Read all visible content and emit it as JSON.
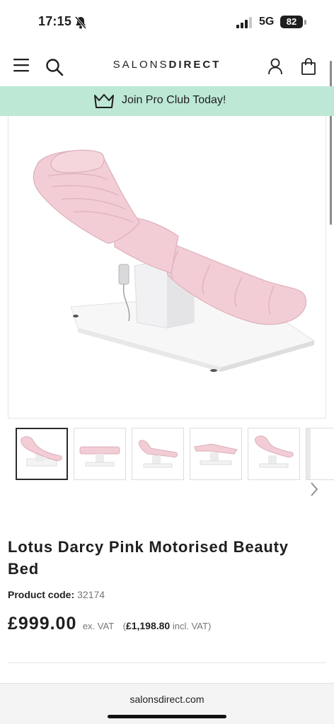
{
  "status_bar": {
    "time": "17:15",
    "network": "5G",
    "battery": "82",
    "icons": [
      "bell-off-icon",
      "signal-icon",
      "battery-icon"
    ]
  },
  "header": {
    "logo_light": "SALONS",
    "logo_bold": "DIRECT",
    "icons": [
      "menu-icon",
      "search-icon",
      "account-icon",
      "bag-icon"
    ]
  },
  "promo": {
    "text": "Join Pro Club Today!",
    "icon": "crown-icon",
    "color": "#bde8d5"
  },
  "gallery": {
    "thumbnail_count": 5,
    "active_index": 0,
    "next_icon": "chevron-right-icon",
    "product_color": "#f2cdd5"
  },
  "product": {
    "title": "Lotus Darcy Pink Motorised Beauty Bed",
    "code_label": "Product code:",
    "code_value": "32174",
    "price": "£999.00",
    "ex_vat_label": "ex. VAT",
    "inc_open": "(",
    "inc_price": "£1,198.80",
    "inc_vat_label": "incl. VAT)"
  },
  "browser": {
    "url": "salonsdirect.com"
  }
}
